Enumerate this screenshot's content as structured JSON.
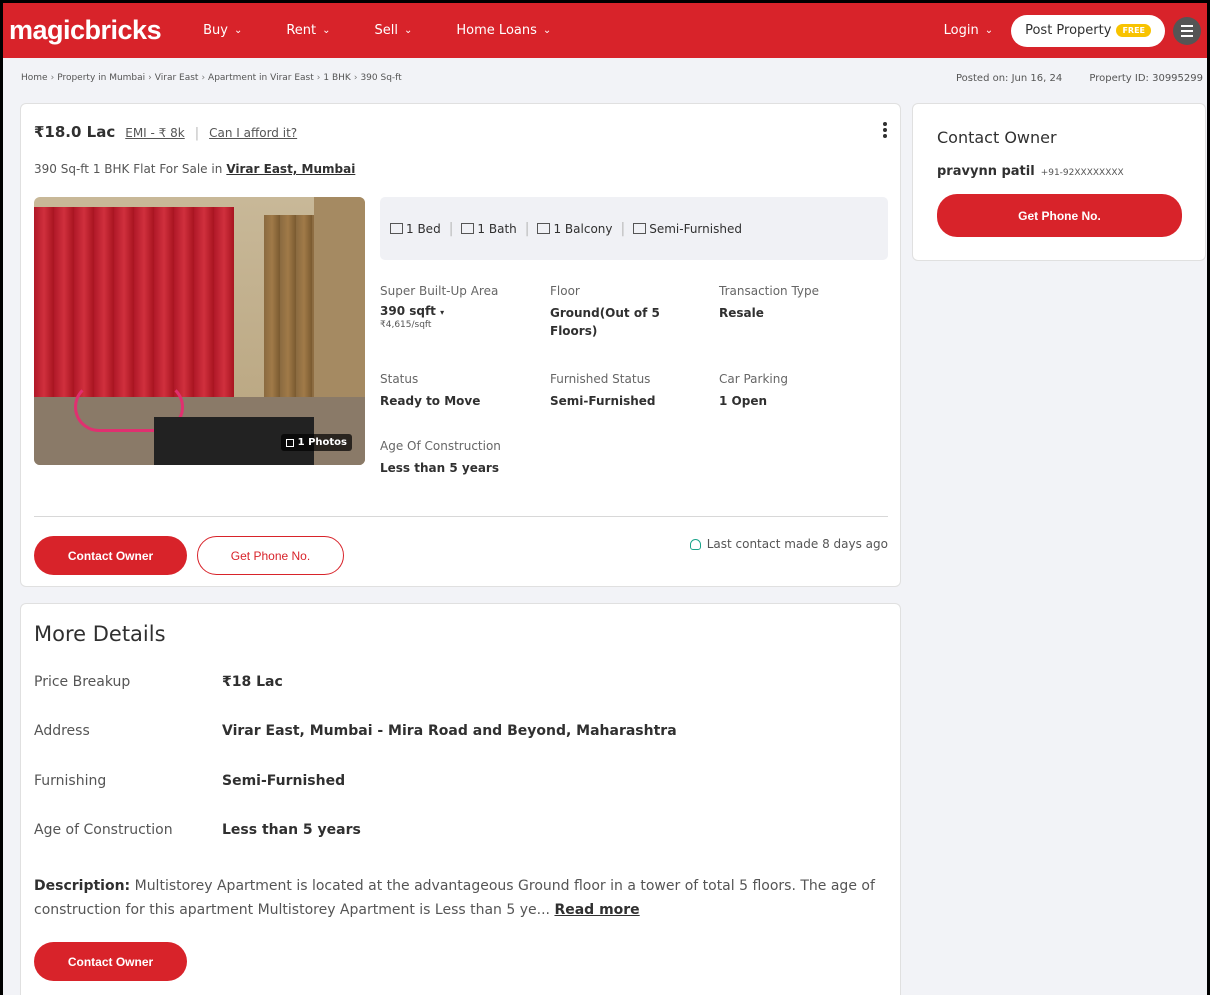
{
  "header": {
    "logo": "magicbricks",
    "nav": [
      {
        "label": "Buy"
      },
      {
        "label": "Rent"
      },
      {
        "label": "Sell"
      },
      {
        "label": "Home Loans"
      }
    ],
    "login": "Login",
    "post_property": "Post Property",
    "free_badge": "FREE",
    "brand_color": "#d8232a"
  },
  "breadcrumb": [
    "Home",
    "Property in Mumbai",
    "Virar East",
    "Apartment in Virar East",
    "1 BHK",
    "390 Sq-ft"
  ],
  "posted_on": "Posted on: Jun 16, 24",
  "property_id": "Property ID: 30995299",
  "listing": {
    "price": "₹18.0 Lac",
    "emi": "EMI - ₹ 8k",
    "afford": "Can I afford it?",
    "subtitle": "390 Sq-ft 1 BHK Flat For Sale in",
    "location_link": "Virar East, Mumbai",
    "photos_label": "1 Photos",
    "amenities": [
      {
        "icon": "bed-icon",
        "label": "1 Bed"
      },
      {
        "icon": "bath-icon",
        "label": "1 Bath"
      },
      {
        "icon": "balcony-icon",
        "label": "1 Balcony"
      },
      {
        "icon": "furnished-icon",
        "label": "Semi-Furnished"
      }
    ],
    "specs": {
      "area_label": "Super Built-Up Area",
      "area_value": "390 sqft",
      "area_rate": "₹4,615/sqft",
      "floor_label": "Floor",
      "floor_value": "Ground(Out of 5 Floors)",
      "transaction_label": "Transaction Type",
      "transaction_value": "Resale",
      "status_label": "Status",
      "status_value": "Ready to Move",
      "furnished_label": "Furnished Status",
      "furnished_value": "Semi-Furnished",
      "parking_label": "Car Parking",
      "parking_value": "1 Open",
      "age_label": "Age Of Construction",
      "age_value": "Less than 5 years"
    },
    "contact_owner": "Contact Owner",
    "get_phone": "Get Phone No.",
    "last_contact": "Last contact made 8 days ago"
  },
  "side": {
    "title": "Contact Owner",
    "owner_name": "pravynn patil",
    "owner_phone": "+91-92XXXXXXXX",
    "get_phone": "Get Phone No."
  },
  "more_details": {
    "title": "More Details",
    "rows": [
      {
        "label": "Price Breakup",
        "value": "₹18 Lac"
      },
      {
        "label": "Address",
        "value": "Virar East, Mumbai - Mira Road and Beyond, Maharashtra"
      },
      {
        "label": "Furnishing",
        "value": "Semi-Furnished"
      },
      {
        "label": "Age of Construction",
        "value": "Less than 5 years"
      }
    ],
    "description_label": "Description:",
    "description_text": "Multistorey Apartment is located at the advantageous Ground floor in a tower of total 5 floors. The age of construction for this apartment Multistorey Apartment is Less than 5 ye...",
    "read_more": "Read more",
    "contact_owner": "Contact Owner"
  }
}
